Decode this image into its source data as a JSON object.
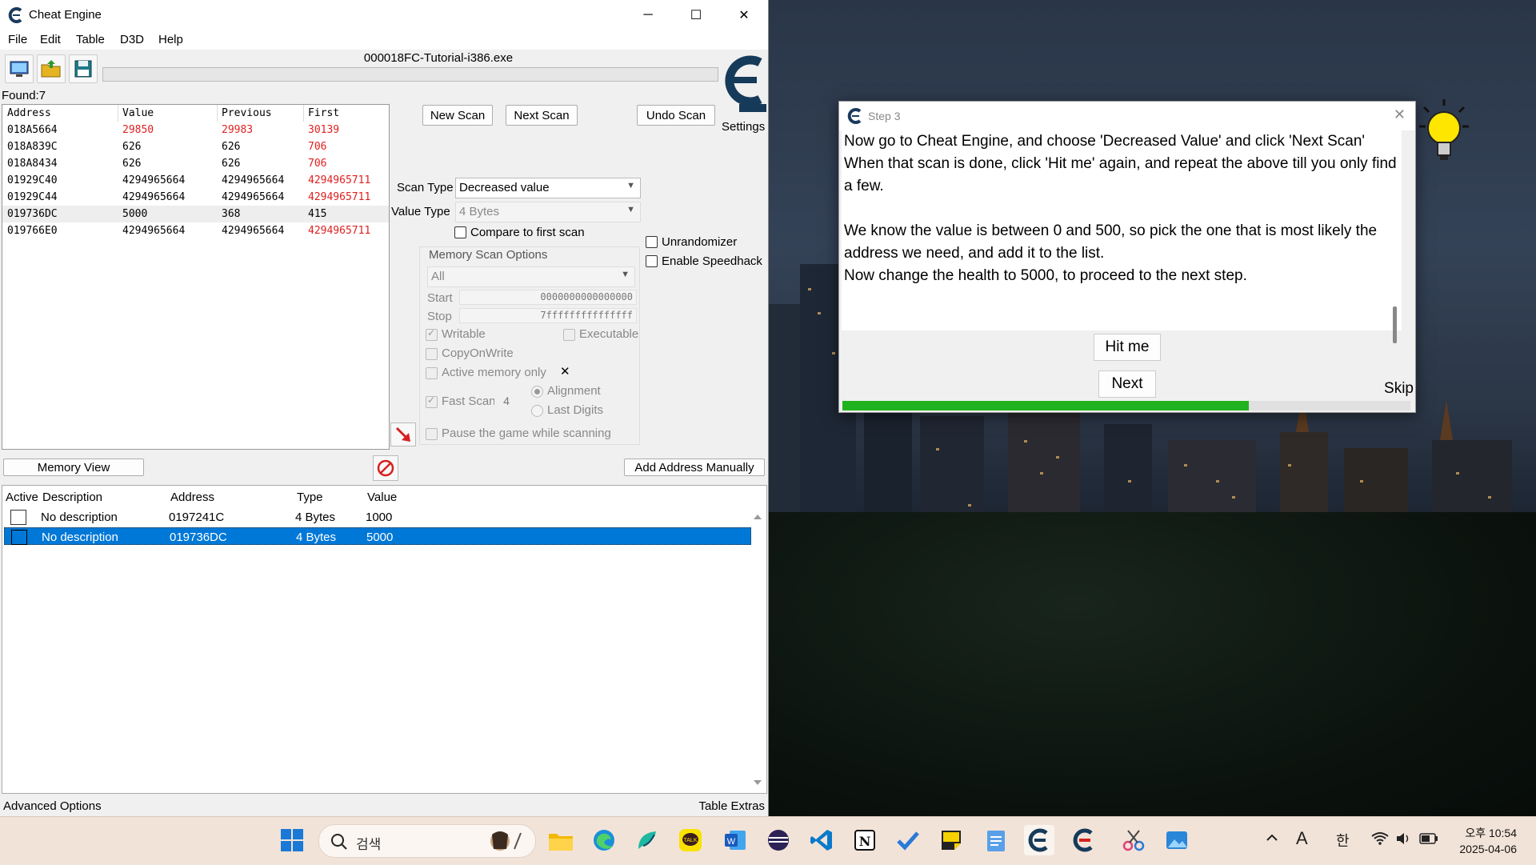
{
  "window": {
    "title": "Cheat Engine",
    "minimize": "─",
    "maximize": "☐",
    "close": "✕"
  },
  "menu": [
    "File",
    "Edit",
    "Table",
    "D3D",
    "Help"
  ],
  "process": {
    "name": "000018FC-Tutorial-i386.exe"
  },
  "settings_label": "Settings",
  "found_label": "Found:7",
  "results": {
    "headers": [
      "Address",
      "Value",
      "Previous",
      "First"
    ],
    "rows": [
      {
        "address": "018A5664",
        "value": "29850",
        "previous": "29983",
        "first": "30139",
        "changed": true
      },
      {
        "address": "018A839C",
        "value": "626",
        "previous": "626",
        "first": "706",
        "changed": false
      },
      {
        "address": "018A8434",
        "value": "626",
        "previous": "626",
        "first": "706",
        "changed": false
      },
      {
        "address": "01929C40",
        "value": "4294965664",
        "previous": "4294965664",
        "first": "4294965711",
        "changed": false
      },
      {
        "address": "01929C44",
        "value": "4294965664",
        "previous": "4294965664",
        "first": "4294965711",
        "changed": false
      },
      {
        "address": "019736DC",
        "value": "5000",
        "previous": "368",
        "first": "415",
        "changed": false,
        "selected": true
      },
      {
        "address": "019766E0",
        "value": "4294965664",
        "previous": "4294965664",
        "first": "4294965711",
        "changed": false
      }
    ]
  },
  "scan": {
    "new_scan": "New Scan",
    "next_scan": "Next Scan",
    "undo_scan": "Undo Scan",
    "scan_type_label": "Scan Type",
    "scan_type_value": "Decreased value",
    "value_type_label": "Value Type",
    "value_type_value": "4 Bytes",
    "compare_first": "Compare to first scan",
    "unrandomizer": "Unrandomizer",
    "speedhack": "Enable Speedhack"
  },
  "memory_options": {
    "title": "Memory Scan Options",
    "region": "All",
    "start_label": "Start",
    "start_value": "0000000000000000",
    "stop_label": "Stop",
    "stop_value": "7fffffffffffffff",
    "writable": "Writable",
    "executable": "Executable",
    "copyonwrite": "CopyOnWrite",
    "active_memory": "Active memory only",
    "fast_scan": "Fast Scan",
    "fast_scan_value": "4",
    "alignment": "Alignment",
    "last_digits": "Last Digits",
    "pause_game": "Pause the game while scanning"
  },
  "memory_view": "Memory View",
  "add_address": "Add Address Manually",
  "address_list": {
    "headers": [
      "Active",
      "Description",
      "Address",
      "Type",
      "Value"
    ],
    "rows": [
      {
        "description": "No description",
        "address": "0197241C",
        "type": "4 Bytes",
        "value": "1000"
      },
      {
        "description": "No description",
        "address": "019736DC",
        "type": "4 Bytes",
        "value": "5000",
        "selected": true
      }
    ]
  },
  "advanced_options": "Advanced Options",
  "table_extras": "Table Extras",
  "tutorial": {
    "title": "Step 3",
    "text": [
      "Now go to Cheat Engine, and choose 'Decreased Value' and click 'Next Scan'",
      "When that scan is done, click 'Hit me' again, and repeat the above till you only find a few.",
      "",
      "We know the value is between 0 and 500, so pick the one that is most likely the address we need, and add it to the list.",
      "Now change the health to 5000, to proceed to the next step."
    ],
    "hit_me": "Hit me",
    "next": "Next",
    "skip": "Skip",
    "progress": 0.715
  },
  "taskbar": {
    "search_placeholder": "검색",
    "ime_mode": "한",
    "font_indicator": "A",
    "time": "오후 10:54",
    "date": "2025-04-06"
  },
  "colors": {
    "changed_value": "#e02020",
    "selection": "#0078d7",
    "progress": "#21b21f"
  }
}
